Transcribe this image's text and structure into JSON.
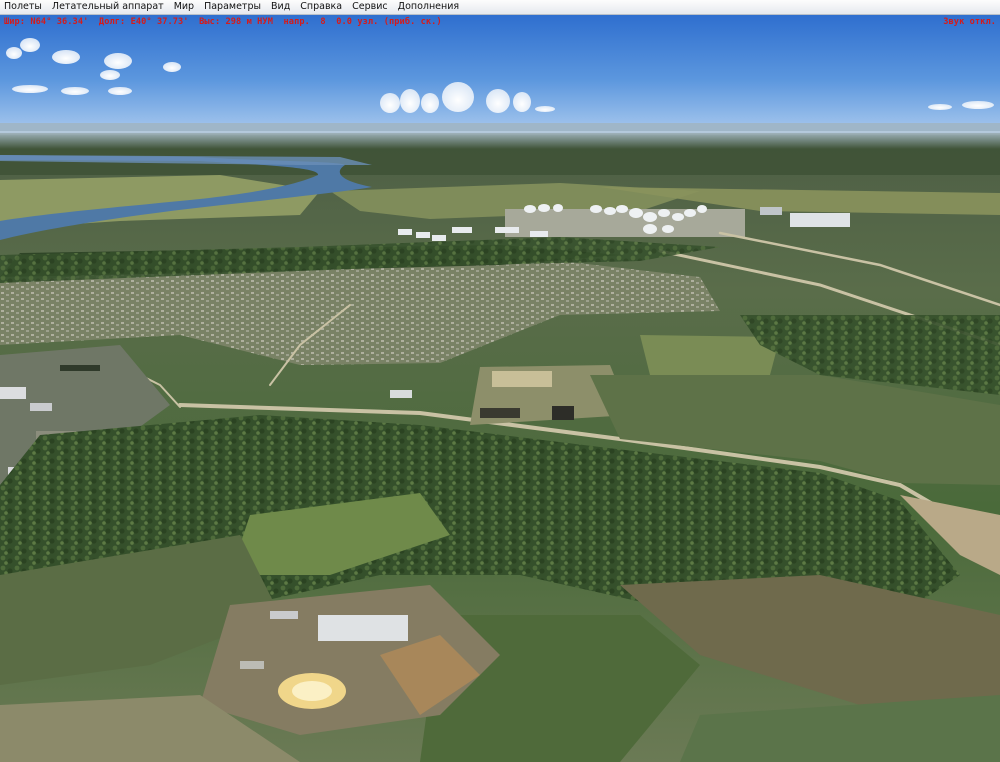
{
  "menu": {
    "items": [
      {
        "id": "flights",
        "label": "Полеты"
      },
      {
        "id": "aircraft",
        "label": "Летательный аппарат"
      },
      {
        "id": "world",
        "label": "Мир"
      },
      {
        "id": "options",
        "label": "Параметры"
      },
      {
        "id": "view",
        "label": "Вид"
      },
      {
        "id": "help",
        "label": "Справка"
      },
      {
        "id": "services",
        "label": "Сервис"
      },
      {
        "id": "addons",
        "label": "Дополнения"
      }
    ]
  },
  "hud": {
    "coordinates": "Шир: N64° 36.34'  Долг: E40° 37.73'  Выс: 298 м НУМ  напр.  8  0.0 узл. (приб. ск.)",
    "sound": "Звук откл.",
    "color": "#d41c1c"
  },
  "scene": {
    "description_color_sky": "#7fb0e6",
    "description_color_forest": "#3f5a35"
  }
}
